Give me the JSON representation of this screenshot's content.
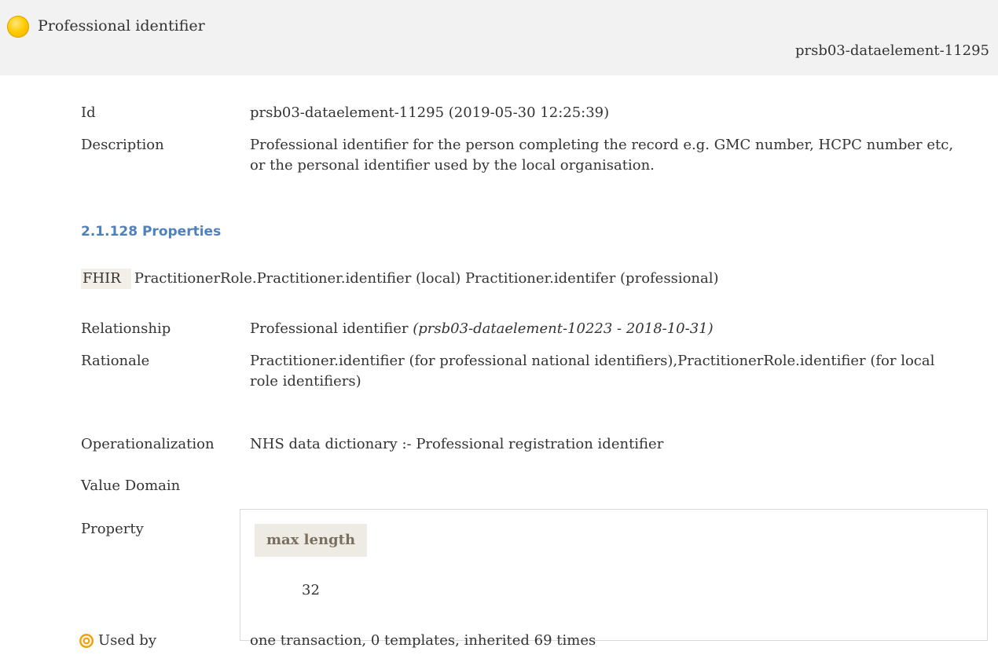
{
  "header": {
    "title": "Professional identifier",
    "element_id": "prsb03-dataelement-11295",
    "status_color": "#ffcc00"
  },
  "details": {
    "id_label": "Id",
    "id_value": "prsb03-dataelement-11295 (2019-05-30 12:25:39)",
    "description_label": "Description",
    "description_value": "Professional identifier for the person completing the record e.g. GMC number, HCPC number etc, or the personal identifier used by the local organisation."
  },
  "properties_section": {
    "heading": "2.1.128 Properties",
    "fhir_badge": "FHIR",
    "fhir_value": "PractitionerRole.Practitioner.identifier (local) Practitioner.identifer (professional)"
  },
  "relationship": {
    "label": "Relationship",
    "value": "Professional identifier",
    "reference": "(prsb03-dataelement-10223 - 2018-10-31)"
  },
  "rationale": {
    "label": "Rationale",
    "value": "Practitioner.identifier (for professional national identifiers),PractitionerRole.identifier (for local role identifiers)"
  },
  "operationalization": {
    "label": "Operationalization",
    "value": "NHS data dictionary :- Professional registration identifier"
  },
  "value_domain": {
    "label": "Value Domain"
  },
  "property": {
    "label": "Property",
    "header": "max length",
    "value": "32"
  },
  "used_by": {
    "icon": "target-icon",
    "label": "Used by",
    "value": "one transaction, 0 templates, inherited 69 times"
  },
  "colors": {
    "heading_blue": "#4f81bd",
    "badge_bg": "#f3eee7",
    "header_bg": "#f2f2f2",
    "usedby_orange": "#f0a30a"
  }
}
